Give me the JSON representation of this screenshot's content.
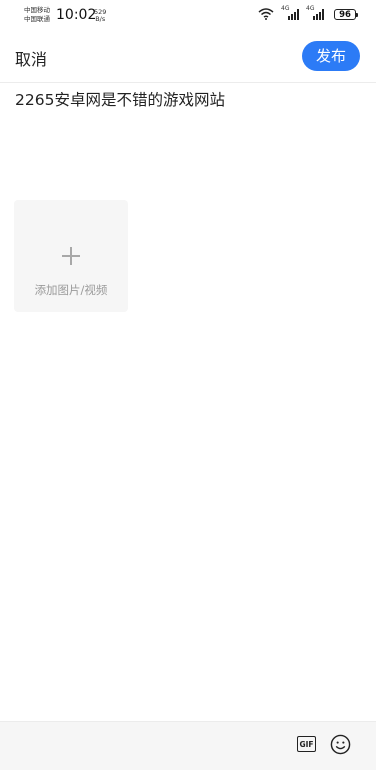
{
  "status_bar": {
    "carrier_1": "中国移动",
    "carrier_2": "中国联通",
    "time": "10:02",
    "net_speed_value": "529",
    "net_speed_unit": "B/s",
    "signal_1_label": "4G",
    "signal_2_label": "4G",
    "battery": "96",
    "icons": [
      "wifi-icon",
      "signal-4g-icon",
      "signal-4g-icon",
      "battery-icon"
    ]
  },
  "header": {
    "cancel_label": "取消",
    "publish_label": "发布",
    "accent_color": "#2c7bf6"
  },
  "composer": {
    "text": "2265安卓网是不错的游戏网站"
  },
  "media": {
    "add_label": "添加图片/视频"
  },
  "toolbar": {
    "gif_label": "GIF",
    "emoji_icon": "emoji-smile-icon"
  }
}
